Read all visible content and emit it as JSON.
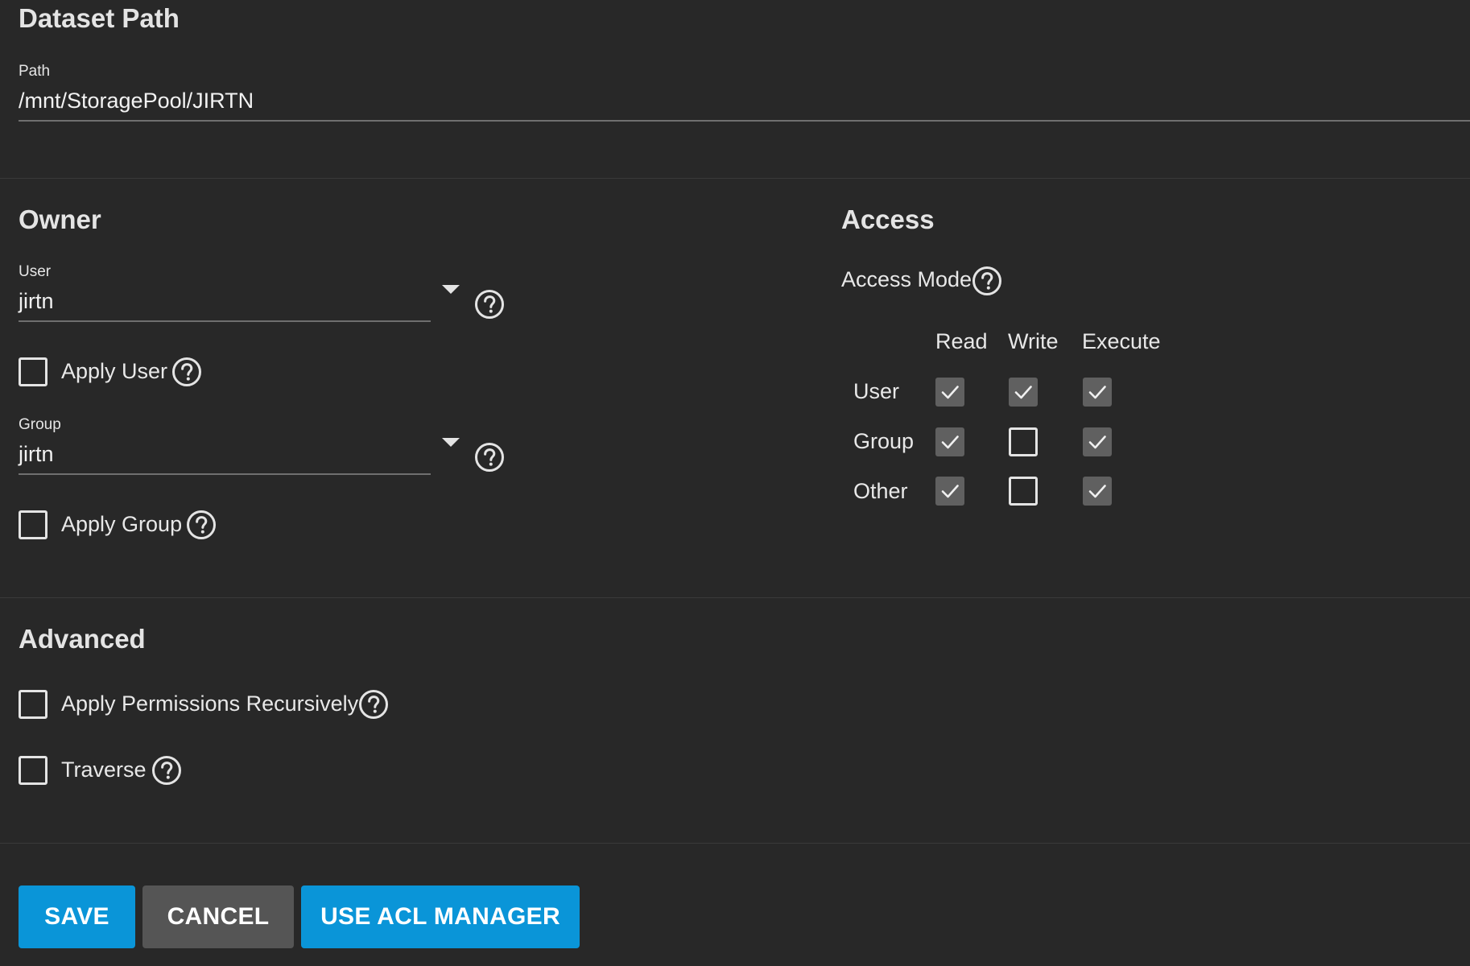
{
  "dataset": {
    "title": "Dataset Path",
    "path_label": "Path",
    "path_value": "/mnt/StoragePool/JIRTN"
  },
  "owner": {
    "title": "Owner",
    "user_label": "User",
    "user_value": "jirtn",
    "apply_user_label": "Apply User",
    "group_label": "Group",
    "group_value": "jirtn",
    "apply_group_label": "Apply Group"
  },
  "access": {
    "title": "Access",
    "mode_label": "Access Mode",
    "columns": [
      "Read",
      "Write",
      "Execute"
    ],
    "rows": [
      {
        "label": "User",
        "read": true,
        "write": true,
        "execute": true
      },
      {
        "label": "Group",
        "read": true,
        "write": false,
        "execute": true
      },
      {
        "label": "Other",
        "read": true,
        "write": false,
        "execute": true
      }
    ]
  },
  "advanced": {
    "title": "Advanced",
    "recursive_label": "Apply Permissions Recursively",
    "traverse_label": "Traverse"
  },
  "buttons": {
    "save": "SAVE",
    "cancel": "CANCEL",
    "acl": "USE ACL MANAGER"
  },
  "colors": {
    "background": "#282828",
    "primary_button": "#0a95d8",
    "secondary_button": "#555555",
    "checked_box": "#606060"
  },
  "icons": {
    "help": "help-circle-icon",
    "dropdown": "caret-down-icon",
    "check": "check-icon"
  }
}
